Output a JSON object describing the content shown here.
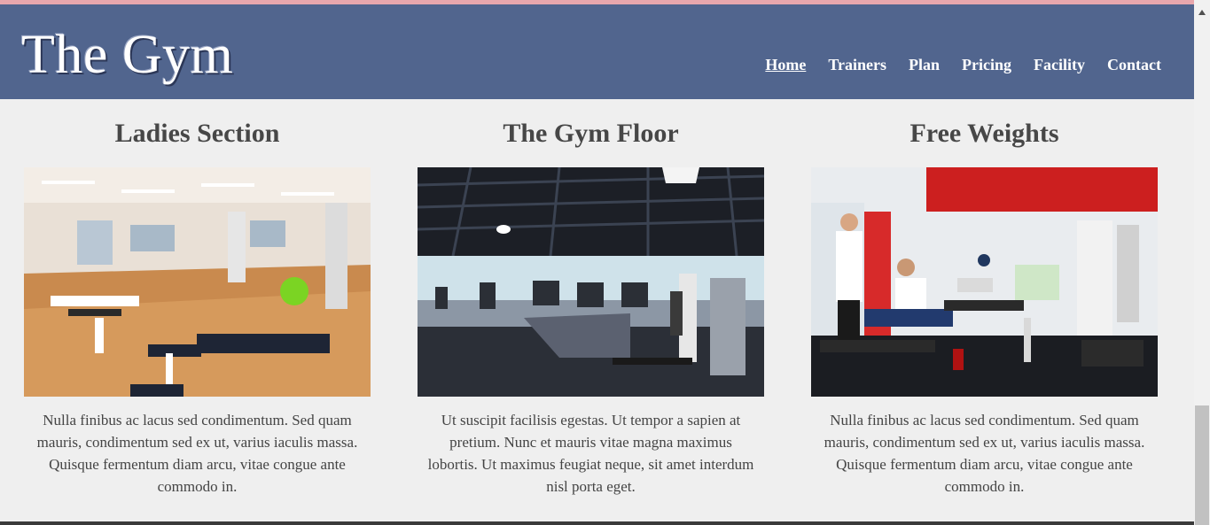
{
  "site": {
    "logo": "The Gym"
  },
  "nav": [
    {
      "label": "Home",
      "active": true
    },
    {
      "label": "Trainers"
    },
    {
      "label": "Plan"
    },
    {
      "label": "Pricing"
    },
    {
      "label": "Facility"
    },
    {
      "label": "Contact"
    }
  ],
  "sections": [
    {
      "title": "Ladies Section",
      "image_alt": "Bright gym room with wooden floor and exercise machines",
      "text": "Nulla finibus ac lacus sed condimentum. Sed quam mauris, condimentum sed ex ut, varius iaculis massa. Quisque fermentum diam arcu, vitae congue ante commodo in."
    },
    {
      "title": "The Gym Floor",
      "image_alt": "Large gym floor with treadmills and weight machines",
      "text": "Ut suscipit facilisis egestas. Ut tempor a sapien at pretium. Nunc et mauris vitae magna maximus lobortis. Ut maximus feugiat neque, sit amet interdum nisl porta eget."
    },
    {
      "title": "Free Weights",
      "image_alt": "People training with free weights on benches",
      "text": "Nulla finibus ac lacus sed condimentum. Sed quam mauris, condimentum sed ex ut, varius iaculis massa. Quisque fermentum diam arcu, vitae congue ante commodo in."
    }
  ],
  "colors": {
    "header": "#51658e",
    "accent_strip": "#e8a7ad",
    "background": "#efefef"
  }
}
